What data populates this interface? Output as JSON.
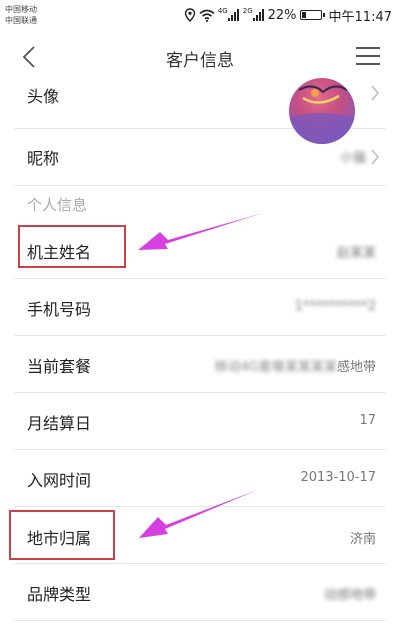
{
  "status_bar": {
    "carrier_1": "中国移动",
    "carrier_2": "中国联通",
    "signal_tag_1": "4G",
    "signal_tag_2": "2G",
    "battery_percent": "22%",
    "battery_level": 0.22,
    "time": "中午11:47"
  },
  "nav": {
    "title": "客户信息"
  },
  "rows": {
    "avatar_label": "头像",
    "nickname_label": "昵称",
    "nickname_value": "小猫",
    "section_personal": "个人信息",
    "owner_name_label": "机主姓名",
    "owner_name_value": "赵某某",
    "phone_label": "手机号码",
    "phone_value": "1**********2",
    "plan_label": "当前套餐",
    "plan_value_prefix": "移动4G套餐某某某某",
    "plan_value_suffix": "感地带",
    "billing_day_label": "月结算日",
    "billing_day_value": "17",
    "join_time_label": "入网时间",
    "join_time_value": "2013-10-17",
    "region_label": "地市归属",
    "region_value": "济南",
    "brand_label": "品牌类型",
    "brand_value": "动感地带"
  },
  "colors": {
    "annotation_box": "#c8424a",
    "annotation_arrow": "#d63fe0",
    "section_header_text": "#aaaaaa",
    "divider": "#e6e6e6"
  },
  "icons": [
    "back-chevron-icon",
    "hamburger-menu-icon",
    "chevron-right-icon",
    "wifi-icon",
    "location-icon",
    "signal-icon",
    "battery-icon"
  ]
}
